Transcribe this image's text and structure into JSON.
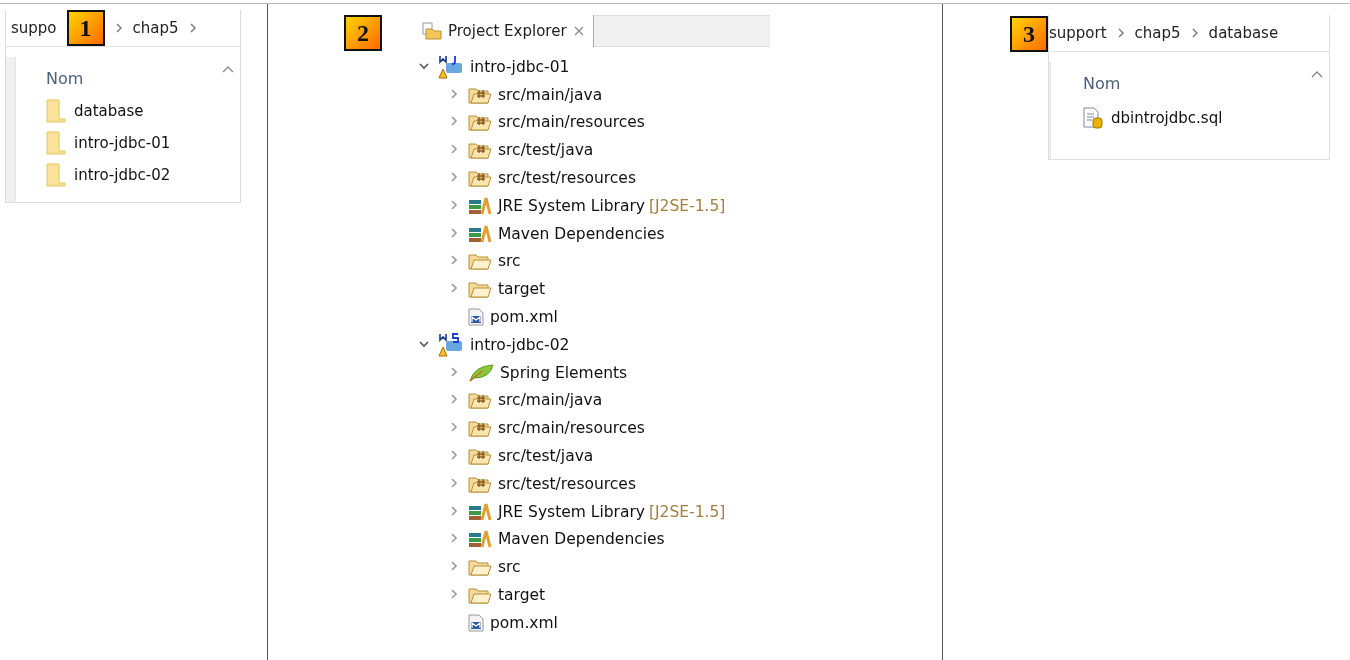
{
  "explorer_1": {
    "badge": "1",
    "breadcrumb": [
      "suppo",
      "chap5"
    ],
    "trailing_chevron": true,
    "column_header": "Nom",
    "files": [
      {
        "name": "database",
        "kind": "folder"
      },
      {
        "name": "intro-jdbc-01",
        "kind": "folder"
      },
      {
        "name": "intro-jdbc-02",
        "kind": "folder"
      }
    ]
  },
  "project_explorer": {
    "badge": "2",
    "tab": {
      "label": "Project Explorer",
      "selected": true
    },
    "projects": [
      {
        "name": "intro-jdbc-01",
        "kind": "maven",
        "expanded": true,
        "children": [
          {
            "name": "src/main/java",
            "kind": "source-folder",
            "expanded": false
          },
          {
            "name": "src/main/resources",
            "kind": "source-folder",
            "expanded": false
          },
          {
            "name": "src/test/java",
            "kind": "source-folder",
            "expanded": false
          },
          {
            "name": "src/test/resources",
            "kind": "source-folder",
            "expanded": false
          },
          {
            "name": "JRE System Library",
            "decoration": "[J2SE-1.5]",
            "kind": "library",
            "expanded": false
          },
          {
            "name": "Maven Dependencies",
            "kind": "library",
            "expanded": false
          },
          {
            "name": "src",
            "kind": "folder",
            "expanded": false
          },
          {
            "name": "target",
            "kind": "folder",
            "expanded": false
          },
          {
            "name": "pom.xml",
            "kind": "file"
          }
        ]
      },
      {
        "name": "intro-jdbc-02",
        "kind": "spring",
        "expanded": true,
        "children": [
          {
            "name": "Spring Elements",
            "kind": "spring-elements",
            "expanded": false
          },
          {
            "name": "src/main/java",
            "kind": "source-folder",
            "expanded": false
          },
          {
            "name": "src/main/resources",
            "kind": "source-folder",
            "expanded": false
          },
          {
            "name": "src/test/java",
            "kind": "source-folder",
            "expanded": false
          },
          {
            "name": "src/test/resources",
            "kind": "source-folder",
            "expanded": false
          },
          {
            "name": "JRE System Library",
            "decoration": "[J2SE-1.5]",
            "kind": "library",
            "expanded": false
          },
          {
            "name": "Maven Dependencies",
            "kind": "library",
            "expanded": false
          },
          {
            "name": "src",
            "kind": "folder",
            "expanded": false
          },
          {
            "name": "target",
            "kind": "folder",
            "expanded": false
          },
          {
            "name": "pom.xml",
            "kind": "file"
          }
        ]
      }
    ]
  },
  "explorer_3": {
    "badge": "3",
    "breadcrumb": [
      "support",
      "chap5",
      "database"
    ],
    "trailing_chevron": false,
    "column_header": "Nom",
    "files": [
      {
        "name": "dbintrojdbc.sql",
        "kind": "sql"
      }
    ]
  }
}
